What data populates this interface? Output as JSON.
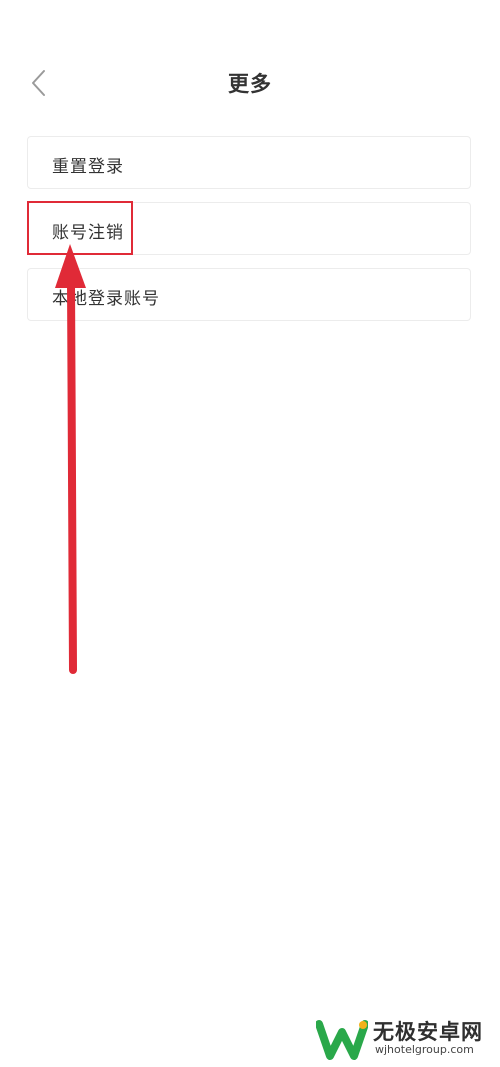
{
  "header": {
    "title": "更多",
    "back_icon": "chevron-left-icon"
  },
  "menu": {
    "items": [
      {
        "label": "重置登录"
      },
      {
        "label": "账号注销"
      },
      {
        "label": "本地登录账号"
      }
    ]
  },
  "annotation": {
    "color": "#e02a37",
    "highlighted_item": "账号注销"
  },
  "watermark": {
    "brand": "无极安卓网",
    "url": "wjhotelgroup.com",
    "logo_icon": "w-logo-icon",
    "logo_color": "#2aa84a"
  }
}
